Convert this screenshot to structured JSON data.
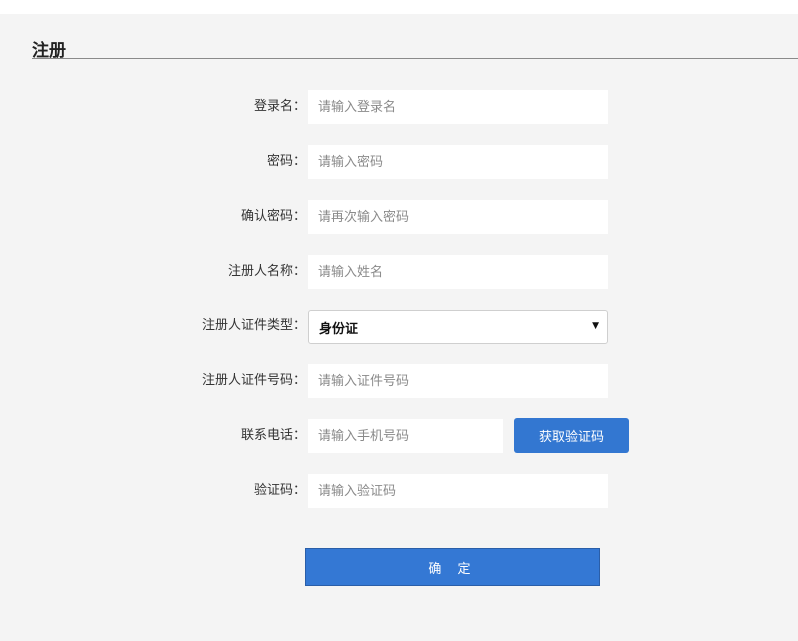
{
  "form": {
    "title": "注册",
    "fields": {
      "login_name": {
        "label": "登录名：",
        "placeholder": "请输入登录名"
      },
      "password": {
        "label": "密码：",
        "placeholder": "请输入密码"
      },
      "confirm_password": {
        "label": "确认密码：",
        "placeholder": "请再次输入密码"
      },
      "registrant_name": {
        "label": "注册人名称：",
        "placeholder": "请输入姓名"
      },
      "id_type": {
        "label": "注册人证件类型：",
        "value": "身份证"
      },
      "id_number": {
        "label": "注册人证件号码：",
        "placeholder": "请输入证件号码"
      },
      "phone": {
        "label": "联系电话：",
        "placeholder": "请输入手机号码"
      },
      "verify_code": {
        "label": "验证码：",
        "placeholder": "请输入验证码"
      }
    },
    "get_code_button": "获取验证码",
    "submit_button": "确 定"
  },
  "icons": {
    "select_arrow": "chevron-down-icon"
  },
  "colors": {
    "primary": "#3377d1",
    "background": "#f4f4f4"
  }
}
